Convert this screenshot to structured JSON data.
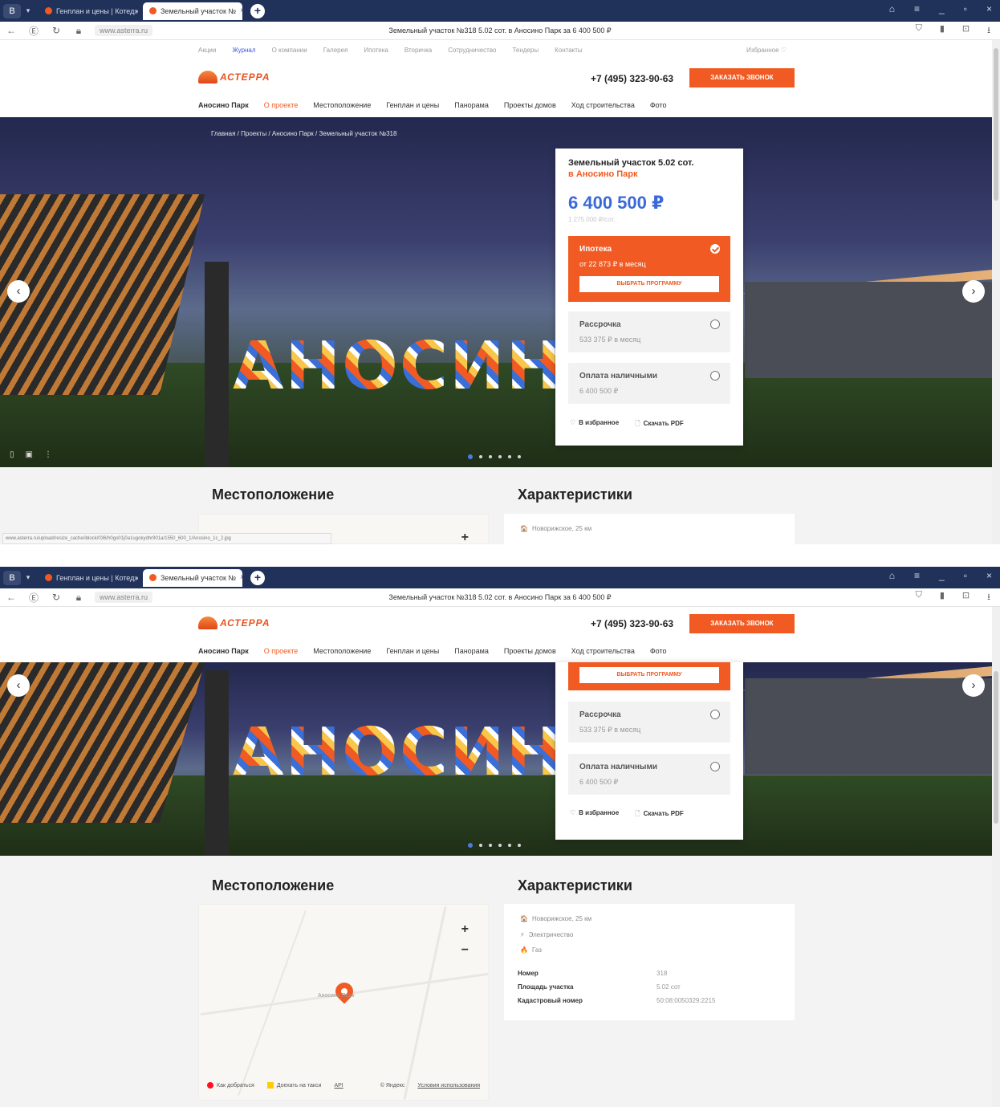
{
  "browser": {
    "tabs": [
      {
        "label": "Генплан и цены | Котедж"
      },
      {
        "label": "Земельный участок №"
      }
    ],
    "new_tab": "+",
    "url": "www.asterra.ru",
    "page_title": "Земельный участок №318 5.02 сот. в Аносино Парк за 6 400 500 ₽",
    "window_controls": [
      "⌂",
      "≡",
      "_",
      "▫",
      "×"
    ],
    "status_url": "www.asterra.ru/upload/resize_cache/iblock/036/h0go01j0a1ugokydhr901a/1550_600_1/Anosino_1c_2.jpg"
  },
  "site": {
    "topnav": [
      "Акции",
      "Журнал",
      "О компании",
      "Галерея",
      "Ипотека",
      "Вторичка",
      "Сотрудничество",
      "Тендеры",
      "Контакты"
    ],
    "topnav_active": "Журнал",
    "favorites": "Избранное ♡",
    "logo": "АСТЕРРА",
    "phone": "+7 (495) 323-90-63",
    "call_button": "ЗАКАЗАТЬ ЗВОНОК",
    "mainnav": [
      "Аносино Парк",
      "О проекте",
      "Местоположение",
      "Генплан и цены",
      "Панорама",
      "Проекты домов",
      "Ход строительства",
      "Фото"
    ],
    "mainnav_active": "О проекте",
    "breadcrumb": "Главная / Проекты / Аносино Парк / Земельный участок №318",
    "hero_sign": [
      "А",
      "Н",
      "О",
      "С",
      "И",
      "Н"
    ]
  },
  "card": {
    "title_line1": "Земельный участок 5.02 сот.",
    "title_line2": "в Аносино Парк",
    "price": "6 400 500 ₽",
    "per_sot": "1 275 000 ₽/сот.",
    "options": [
      {
        "name": "Ипотека",
        "value": "от 22 873 ₽ в месяц",
        "selected": true,
        "button": "ВЫБРАТЬ ПРОГРАММУ"
      },
      {
        "name": "Рассрочка",
        "value": "533 375 ₽ в месяц",
        "selected": false
      },
      {
        "name": "Оплата наличными",
        "value": "6 400 500 ₽",
        "selected": false
      }
    ],
    "favorite": "В избранное",
    "pdf": "Скачать PDF"
  },
  "sections": {
    "location": "Местоположение",
    "characteristics": "Характеристики"
  },
  "map": {
    "zoom_in": "+",
    "zoom_out": "−",
    "pin_label": "Аносино Парк",
    "route": "Как добраться",
    "taxi": "Доехать на такси",
    "api": "API",
    "copyright": "© Яндекс",
    "terms": "Условия использования"
  },
  "characteristics": {
    "features": [
      {
        "icon": "🏠",
        "text": "Новорижское, 25 км"
      },
      {
        "icon": "⚡",
        "text": "Электричество"
      },
      {
        "icon": "🔥",
        "text": "Газ"
      }
    ],
    "rows": [
      {
        "key": "Номер",
        "value": "318"
      },
      {
        "key": "Площадь участка",
        "value": "5.02 сот"
      },
      {
        "key": "Кадастровый номер",
        "value": "50:08:0050329:2215"
      }
    ]
  },
  "colors": {
    "accent": "#f15a22",
    "price_blue": "#3b69d9",
    "chrome": "#20325a"
  }
}
